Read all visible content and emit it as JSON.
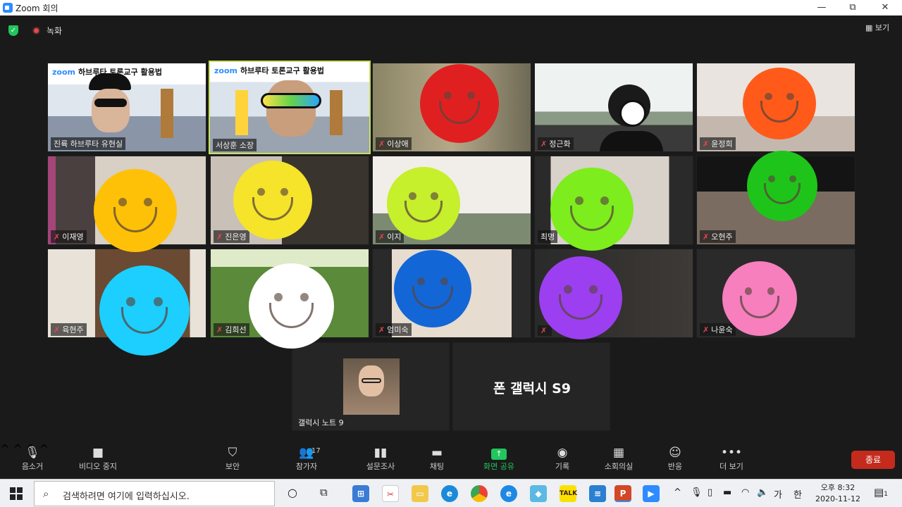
{
  "window": {
    "title": "Zoom 회의",
    "minimize": "—",
    "restore": "⧉",
    "close": "✕"
  },
  "meeting_bar": {
    "recording_label": "녹화",
    "view_label": "보기"
  },
  "banner": {
    "logo": "zoom",
    "text": "하브루타 토론교구 활용법"
  },
  "participants": [
    {
      "name": "진륙 하브루타 유현실",
      "muted": false
    },
    {
      "name": "서상훈 소장",
      "muted": false
    },
    {
      "name": "이상애",
      "muted": true
    },
    {
      "name": "정근화",
      "muted": true
    },
    {
      "name": "윤정희",
      "muted": true
    },
    {
      "name": "이재영",
      "muted": true
    },
    {
      "name": "진은영",
      "muted": true
    },
    {
      "name": "이지",
      "muted": true
    },
    {
      "name": "최명",
      "muted": false
    },
    {
      "name": "오현주",
      "muted": true
    },
    {
      "name": "육현주",
      "muted": true
    },
    {
      "name": "김희선",
      "muted": true
    },
    {
      "name": "엄미숙",
      "muted": true
    },
    {
      "name": "",
      "muted": true
    },
    {
      "name": "나윤숙",
      "muted": true
    },
    {
      "name": "갤럭시 노트 9",
      "muted": false
    },
    {
      "name": "",
      "muted": false
    }
  ],
  "phone_tile_label": "폰 갤럭시 S9",
  "smiley_colors": [
    "#e02020",
    "#ff5a1a",
    "#ffc107",
    "#f5e42a",
    "#c6ef2c",
    "#7ded1e",
    "#1fc41a",
    "#1ccfff",
    "#ffffff",
    "#1366d6",
    "#9b3ff0",
    "#f77fbd"
  ],
  "toolbar": {
    "mute_label": "음소거",
    "video_label": "비디오 중지",
    "security_label": "보안",
    "participants_label": "참가자",
    "participants_count": "17",
    "polls_label": "설문조사",
    "chat_label": "채팅",
    "share_label": "화면 공유",
    "record_label": "기록",
    "breakout_label": "소회의실",
    "reactions_label": "반응",
    "more_label": "더 보기",
    "end_label": "종료"
  },
  "taskbar": {
    "search_placeholder": "검색하려면 여기에 입력하십시오.",
    "ime_label": "가",
    "ime_mode": "한",
    "time": "오후 8:32",
    "date": "2020-11-12",
    "notification_count": "1"
  }
}
